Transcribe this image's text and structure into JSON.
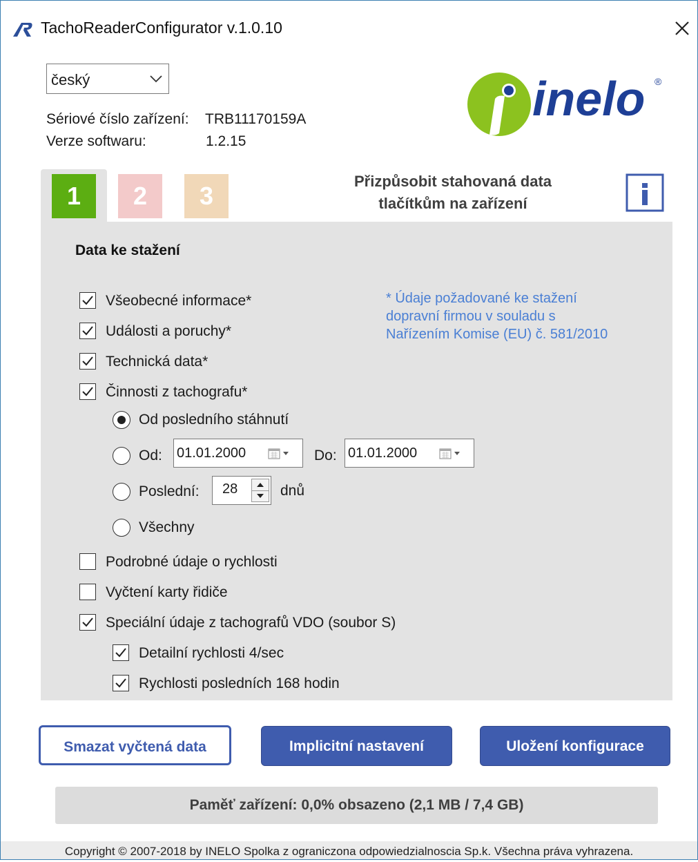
{
  "window": {
    "title": "TachoReaderConfigurator v.1.0.10"
  },
  "language": {
    "selected": "český"
  },
  "device": {
    "serial_label": "Sériové číslo zařízení:",
    "serial_value": "TRB11170159A",
    "software_label": "Verze softwaru:",
    "software_value": "1.2.15"
  },
  "logo": {
    "text": "inelo",
    "registered": "®"
  },
  "tabs": [
    {
      "label": "1",
      "color": "#5cae12",
      "active": true
    },
    {
      "label": "2",
      "color": "#f3caca",
      "active": false
    },
    {
      "label": "3",
      "color": "#f1d8b8",
      "active": false
    }
  ],
  "tab_caption": {
    "line1": "Přizpůsobit stahovaná data",
    "line2": "tlačítkům na zařízení"
  },
  "panel": {
    "title": "Data ke stažení",
    "note": [
      "* Údaje požadované ke stažení",
      "dopravní firmou v souladu s",
      "Nařízením Komise (EU) č. 581/2010"
    ],
    "checkboxes": [
      {
        "label": "Všeobecné informace*",
        "checked": true
      },
      {
        "label": "Události a poruchy*",
        "checked": true
      },
      {
        "label": "Technická data*",
        "checked": true
      },
      {
        "label": "Činnosti z tachografu*",
        "checked": true
      }
    ],
    "radios": {
      "since_last": {
        "label": "Od posledního stáhnutí",
        "selected": true
      },
      "from": {
        "label": "Od:",
        "value": "01.01.2000",
        "to_label": "Do:",
        "to_value": "01.01.2000",
        "selected": false
      },
      "last": {
        "label": "Poslední:",
        "value": "28",
        "unit": "dnů",
        "selected": false
      },
      "all": {
        "label": "Všechny",
        "selected": false
      }
    },
    "extra_checkboxes": [
      {
        "label": "Podrobné údaje o rychlosti",
        "checked": false
      },
      {
        "label": "Vyčtení karty řidiče",
        "checked": false
      },
      {
        "label": "Speciální údaje z tachografů VDO (soubor S)",
        "checked": true
      }
    ],
    "sub_checkboxes": [
      {
        "label": "Detailní rychlosti 4/sec",
        "checked": true
      },
      {
        "label": "Rychlosti posledních 168 hodin",
        "checked": true
      }
    ]
  },
  "buttons": {
    "clear": "Smazat vyčtená data",
    "defaults": "Implicitní nastavení",
    "save": "Uložení konfigurace"
  },
  "memory": {
    "text": "Paměť zařízení: 0,0% obsazeno (2,1 MB / 7,4 GB)"
  },
  "footer": {
    "copyright": "Copyright © 2007-2018 by INELO Spolka z ograniczona odpowiedzialnoscia Sp.k. Všechna práva vyhrazena."
  },
  "colors": {
    "accent": "#3f5cae",
    "note": "#4a7fd4",
    "logo_green": "#8cc21f",
    "logo_blue": "#1e3f96"
  }
}
